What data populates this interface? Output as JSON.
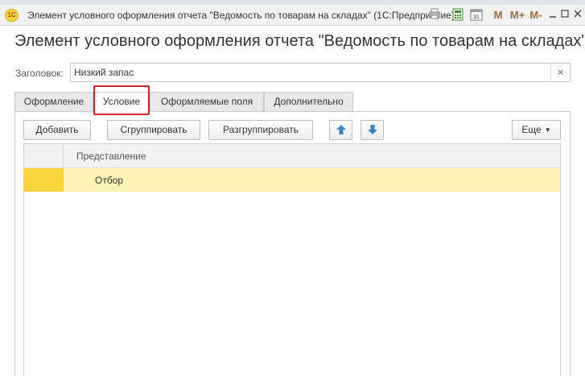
{
  "window": {
    "title": "Элемент условного оформления отчета \"Ведомость по товарам на складах\"  (1С:Предприятие)",
    "logo_text": "1С",
    "toolbar_icons": [
      "print-icon",
      "calculator-icon",
      "calendar-icon",
      "memory-m-icon",
      "memory-plus-icon",
      "memory-minus-icon",
      "minimize-icon",
      "maximize-icon",
      "close-icon"
    ],
    "calendar_label": "31",
    "mem_labels": [
      "M",
      "M+",
      "M-"
    ]
  },
  "form": {
    "title": "Элемент условного оформления отчета \"Ведомость по товарам на складах\"",
    "header_label": "Заголовок:",
    "header_value": "Низкий запас",
    "clear_symbol": "×"
  },
  "tabs": [
    {
      "label": "Оформление",
      "active": false
    },
    {
      "label": "Условие",
      "active": true
    },
    {
      "label": "Оформляемые поля",
      "active": false
    },
    {
      "label": "Дополнительно",
      "active": false
    }
  ],
  "toolbar": {
    "add": "Добавить",
    "group": "Сгруппировать",
    "ungroup": "Разгруппировать",
    "more": "Еще"
  },
  "table": {
    "columns": [
      "Представление"
    ],
    "rows": [
      {
        "value": "Отбор",
        "selected": true
      }
    ]
  },
  "colors": {
    "highlight_frame": "#d2232a",
    "selected_row": "#fbf2b3",
    "row_marker": "#f7d43a",
    "arrow_blue": "#3a87c8"
  }
}
